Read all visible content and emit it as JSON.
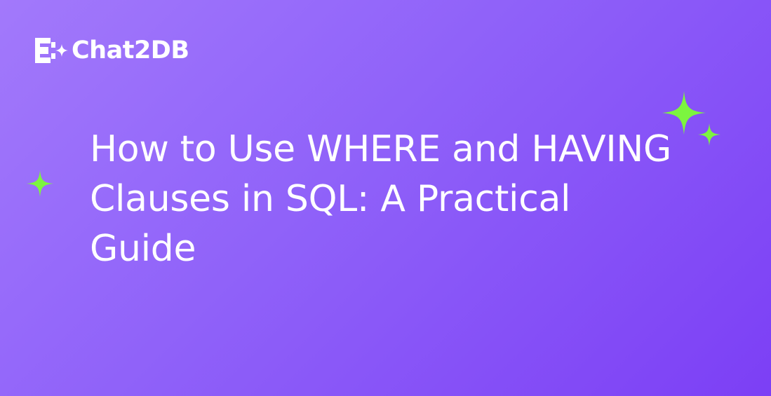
{
  "brand": {
    "name": "Chat2DB",
    "logo_icon": "chat2db-logo-icon"
  },
  "title": {
    "lines": [
      "How to Use WHERE and HAVING",
      "Clauses in SQL: A Practical",
      "Guide"
    ]
  },
  "colors": {
    "background_start": "#a279fb",
    "background_end": "#7c3ff5",
    "text": "#ffffff",
    "sparkle": "#7cf53f"
  },
  "decorations": [
    "sparkle-icon",
    "sparkle-icon",
    "sparkle-icon"
  ]
}
